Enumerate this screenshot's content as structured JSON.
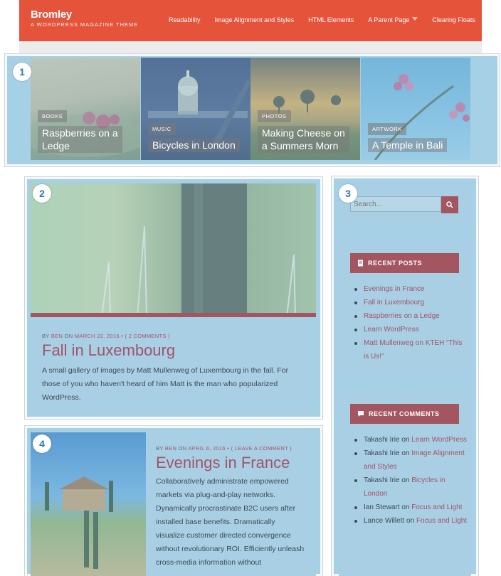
{
  "site": {
    "title": "Bromley",
    "tagline": "A WORDPRESS MAGAZINE THEME"
  },
  "nav": [
    {
      "label": "Readability"
    },
    {
      "label": "Image Alignment and Styles"
    },
    {
      "label": "HTML Elements"
    },
    {
      "label": "A Parent Page",
      "has_dropdown": true
    },
    {
      "label": "Clearing Floats"
    }
  ],
  "region_numbers": [
    "1",
    "2",
    "3",
    "4"
  ],
  "featured": [
    {
      "category": "BOOKS",
      "title_line1": "Raspberries on a",
      "title_line2": "Ledge"
    },
    {
      "category": "MUSIC",
      "title_line1": "Bicycles in London",
      "title_line2": ""
    },
    {
      "category": "PHOTOS",
      "title_line1": "Making Cheese on",
      "title_line2": "a Summers Morn"
    },
    {
      "category": "ARTWORK",
      "title_line1": "A Temple in Bali",
      "title_line2": ""
    }
  ],
  "post_main": {
    "meta_by": "BY",
    "author": "BEN",
    "meta_on": "ON",
    "date": "MARCH 22, 2016",
    "separator": "•",
    "comments": "( 2 COMMENTS )",
    "title": "Fall in Luxembourg",
    "excerpt": "A small gallery of images by Matt Mullenweg of Luxembourg in the fall. For those of you who haven't heard of him Matt is the man who popularized WordPress."
  },
  "post_second": {
    "meta_by": "BY",
    "author": "BEN",
    "meta_on": "ON",
    "date": "APRIL 6, 2016",
    "separator": "•",
    "comments": "( LEAVE A COMMENT )",
    "title": "Evenings in France",
    "excerpt": "Collaboratively administrate empowered markets via plug-and-play networks. Dynamically procrastinate B2C users after installed base benefits. Dramatically visualize customer directed convergence without revolutionary ROI. Efficiently unleash cross-media information without"
  },
  "search": {
    "placeholder": "Search..."
  },
  "recent_posts": {
    "title": "RECENT POSTS",
    "items": [
      "Evenings in France",
      "Fall in Luxembourg",
      "Raspberries on a Ledge",
      "Learn WordPress",
      "Matt Mullenweg on KTEH “This is Us!”"
    ]
  },
  "recent_comments": {
    "title": "RECENT COMMENTS",
    "items": [
      {
        "author": "Takashi Irie",
        "on": "on",
        "post": "Learn WordPress"
      },
      {
        "author": "Takashi Irie",
        "on": "on",
        "post": "Image Alignment and Styles"
      },
      {
        "author": "Takashi Irie",
        "on": "on",
        "post": "Bicycles in London"
      },
      {
        "author": "Ian Stewart",
        "on": "on",
        "post": "Focus and Light"
      },
      {
        "author": "Lance Willett",
        "on": "on",
        "post": "Focus and Light"
      }
    ]
  },
  "colors": {
    "accent": "#e5533b",
    "link": "#a05565",
    "overlay": "#a5d0e6",
    "widget_title_bg": "#a35560"
  }
}
